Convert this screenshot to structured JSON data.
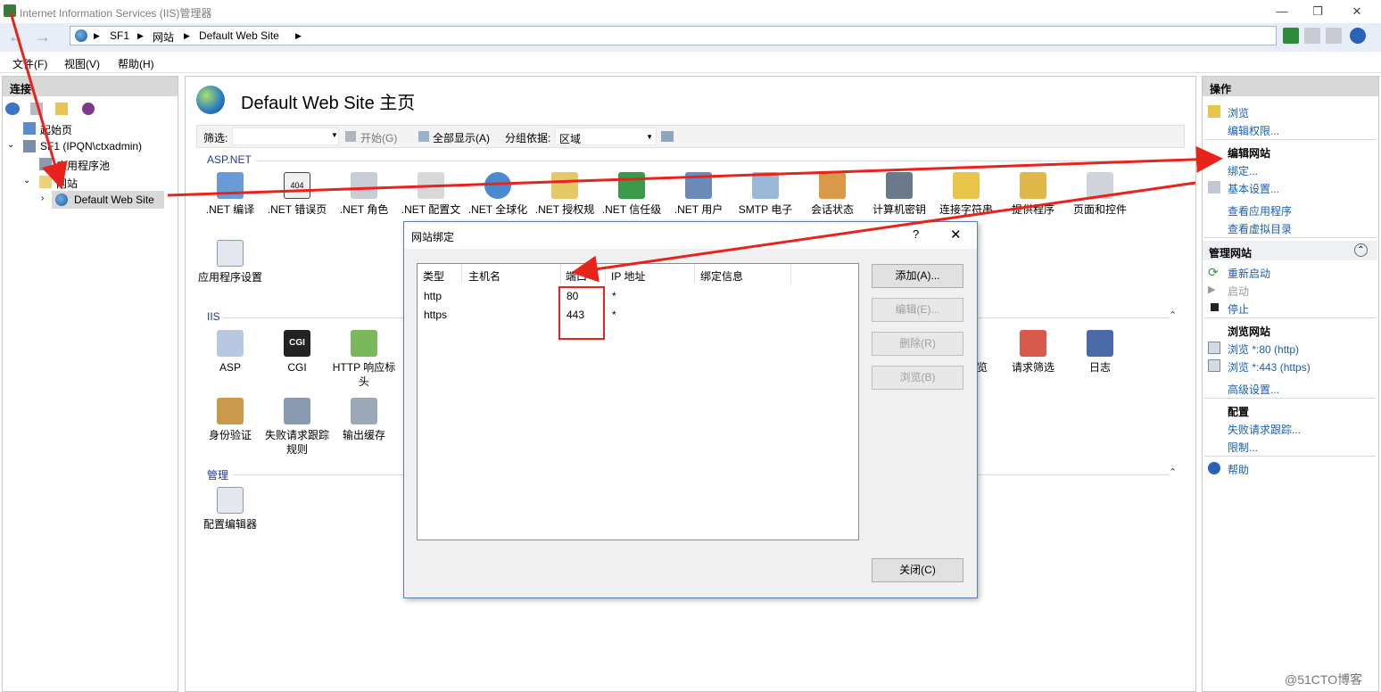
{
  "window": {
    "title": "Internet Information Services (IIS)管理器",
    "minimize": "—",
    "maximize": "❐",
    "close": "✕"
  },
  "address": {
    "parts": [
      "SF1",
      "网站",
      "Default Web Site"
    ],
    "sep": "▶"
  },
  "menu": [
    "文件(F)",
    "视图(V)",
    "帮助(H)"
  ],
  "connections": {
    "header": "连接",
    "tree": {
      "start": "起始页",
      "server": "SF1 (IPQN\\ctxadmin)",
      "apppools": "应用程序池",
      "sites": "网站",
      "site": "Default Web Site"
    }
  },
  "main": {
    "title": "Default Web Site 主页",
    "filter_label": "筛选:",
    "start_btn": "开始(G)",
    "showall_btn": "全部显示(A)",
    "group_label": "分组依据:",
    "group_value": "区域",
    "section_aspnet": "ASP.NET",
    "section_iis": "IIS",
    "section_manage": "管理",
    "aspnet_features": [
      ".NET 编译",
      ".NET 错误页",
      ".NET 角色",
      ".NET 配置文",
      ".NET 全球化",
      ".NET 授权规",
      ".NET 信任级",
      ".NET 用户",
      "SMTP 电子",
      "会话状态",
      "计算机密钥",
      "连接字符串",
      "提供程序",
      "页面和控件",
      "应用程序设置"
    ],
    "iis_features_left": [
      "ASP",
      "CGI",
      "HTTP 响应标头",
      "身份验证",
      "失败请求跟踪规则",
      "输出缓存"
    ],
    "iis_features_right": [
      "览",
      "请求筛选",
      "日志"
    ],
    "manage_features": [
      "配置编辑器"
    ],
    "icon404": "404",
    "iconcgi": "CGI"
  },
  "actions": {
    "header": "操作",
    "browse": "浏览",
    "edit_perm": "编辑权限...",
    "edit_site": "编辑网站",
    "bindings": "绑定...",
    "basic": "基本设置...",
    "view_apps": "查看应用程序",
    "view_vdirs": "查看虚拟目录",
    "manage_site": "管理网站",
    "collapse": "⌃",
    "restart": "重新启动",
    "start": "启动",
    "stop": "停止",
    "browse_site": "浏览网站",
    "browse80": "浏览 *:80 (http)",
    "browse443": "浏览 *:443 (https)",
    "advanced": "高级设置...",
    "config": "配置",
    "failed_trace": "失败请求跟踪...",
    "limits": "限制...",
    "help": "帮助"
  },
  "dialog": {
    "title": "网站绑定",
    "help": "?",
    "close_x": "✕",
    "columns": [
      "类型",
      "主机名",
      "端口",
      "IP 地址",
      "绑定信息"
    ],
    "rows": [
      {
        "type": "http",
        "host": "",
        "port": "80",
        "ip": "*",
        "info": ""
      },
      {
        "type": "https",
        "host": "",
        "port": "443",
        "ip": "*",
        "info": ""
      }
    ],
    "add": "添加(A)...",
    "edit": "编辑(E)...",
    "remove": "删除(R)",
    "browse": "浏览(B)",
    "close": "关闭(C)"
  },
  "watermark": "@51CTO博客",
  "colors": {
    "arrow": "#e8231c",
    "link": "#1a5fb4",
    "section": "#1e3c8c"
  }
}
